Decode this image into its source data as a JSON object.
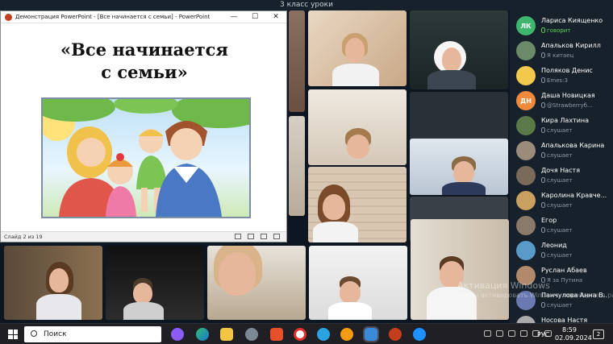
{
  "window": {
    "title": "3 класс уроки"
  },
  "presentation": {
    "window_title": "Демонстрация PowerPoint - [Все начинается с семьи] - PowerPoint",
    "slide_title_line1": "«Все начинается",
    "slide_title_line2": "с семьи»",
    "status": "Слайд 2 из 19",
    "accent": "#c43e1c"
  },
  "participants": [
    {
      "initials": "ЛК",
      "name": "Лариса Киященко",
      "status": "говорит",
      "speaking": true,
      "color": "#3fb66d"
    },
    {
      "initials": "",
      "name": "Апальков Кирилл",
      "status": "Я китаец",
      "speaking": false,
      "color": "#6a8a6a"
    },
    {
      "initials": "",
      "name": "Поляков Денис",
      "status": "Emes:3",
      "speaking": false,
      "color": "#f2c94c"
    },
    {
      "initials": "ДН",
      "name": "Даша Новицкая",
      "status": "@Strawberryб...",
      "speaking": false,
      "color": "#ef8a3c"
    },
    {
      "initials": "",
      "name": "Кира Лахтина",
      "status": "слушает",
      "speaking": false,
      "color": "#5a7a4a"
    },
    {
      "initials": "",
      "name": "Апалькова Карина",
      "status": "слушает",
      "speaking": false,
      "color": "#9b8b7b"
    },
    {
      "initials": "",
      "name": "Дочя Настя",
      "status": "слушает",
      "speaking": false,
      "color": "#7a6a5a"
    },
    {
      "initials": "",
      "name": "Каролина Кравче...",
      "status": "слушает",
      "speaking": false,
      "color": "#c8a060"
    },
    {
      "initials": "",
      "name": "Егор",
      "status": "слушает",
      "speaking": false,
      "color": "#8a7a6a"
    },
    {
      "initials": "",
      "name": "Леонид",
      "status": "слушает",
      "speaking": false,
      "color": "#5a9ac8"
    },
    {
      "initials": "",
      "name": "Руслан Абаев",
      "status": "Я за Путина",
      "speaking": false,
      "color": "#b08a6a"
    },
    {
      "initials": "",
      "name": "Панчулова Анна В...",
      "status": "слушает",
      "speaking": false,
      "color": "#6a7ab0"
    },
    {
      "initials": "",
      "name": "Носова Настя",
      "status": "",
      "speaking": false,
      "color": "#aaaaaa"
    }
  ],
  "watermark": {
    "line1": "Активация Windows",
    "line2": "Чтобы активировать Windows, перейдите в раздел «Параметры»."
  },
  "taskbar": {
    "search_label": "Поиск",
    "lang": "РУС",
    "time": "8:59",
    "date": "02.09.2024",
    "notifications": "2"
  }
}
